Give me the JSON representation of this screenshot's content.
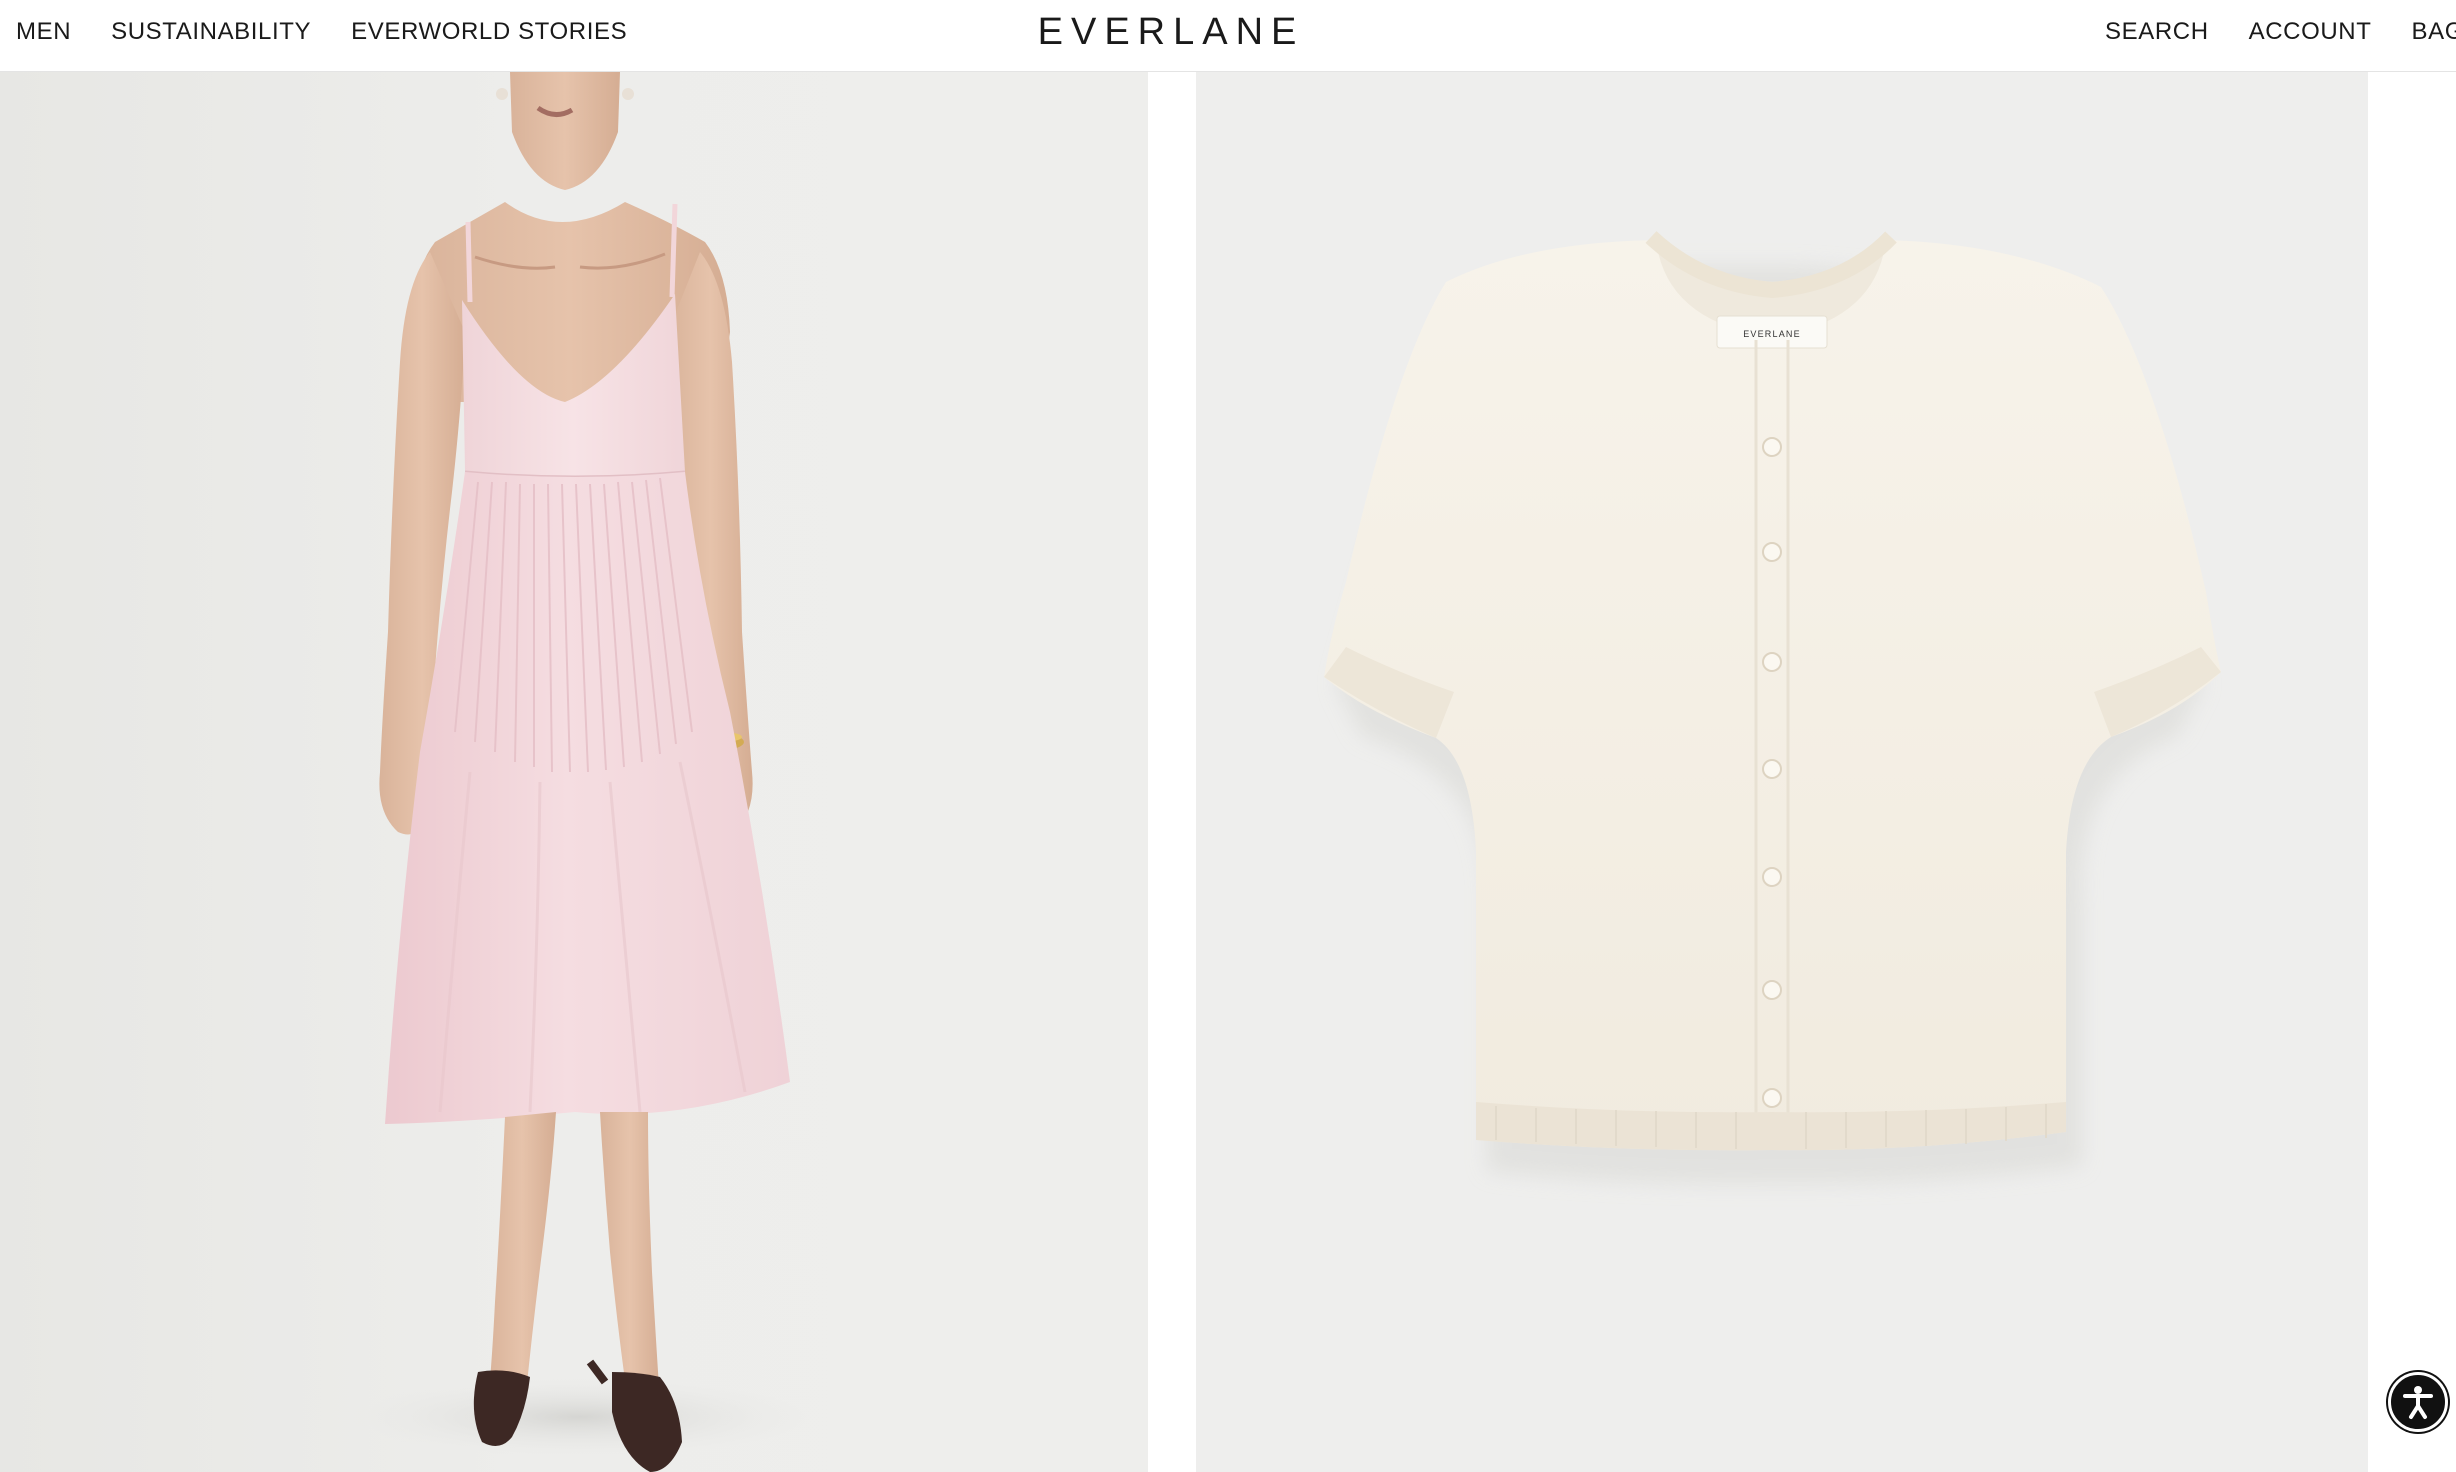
{
  "header": {
    "nav_left": [
      "MEN",
      "SUSTAINABILITY",
      "EVERWORLD STORIES"
    ],
    "logo": "EVERLANE",
    "nav_right": [
      "SEARCH",
      "ACCOUNT",
      "BAG"
    ]
  },
  "products": {
    "left": {
      "image": "woman-in-pink-pleated-slip-dress",
      "dress_color": "#f3d9dd"
    },
    "right": {
      "image": "cream-short-sleeve-cardigan",
      "garment_color": "#f6f1e7",
      "neck_label_text": "EVERLANE"
    }
  },
  "accessibility": {
    "icon": "accessibility-icon",
    "color": "#111111"
  }
}
